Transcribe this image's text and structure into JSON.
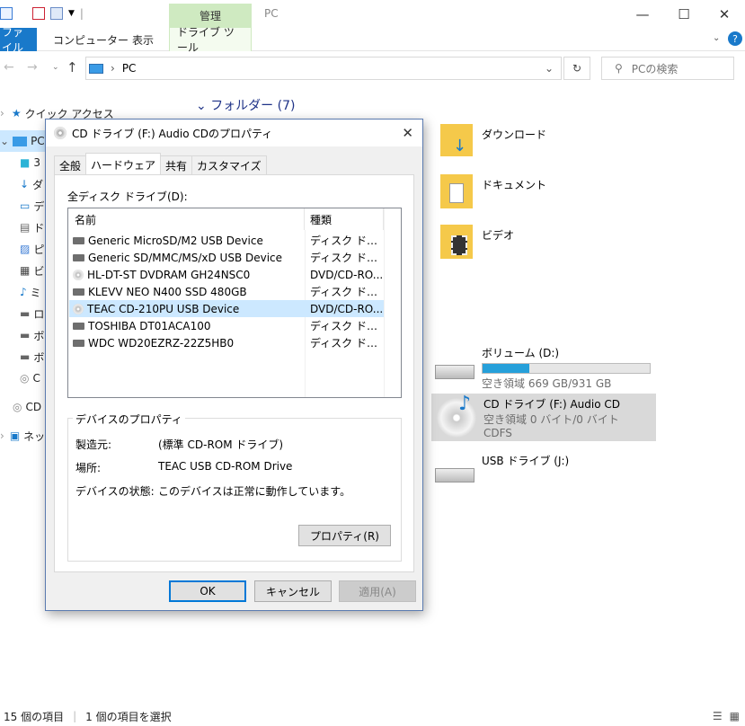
{
  "window": {
    "title": "PC",
    "context_group": "管理"
  },
  "ribbon": {
    "tabs": [
      "ファイル",
      "コンピューター",
      "表示"
    ],
    "context_tab": "ドライブ ツール"
  },
  "address": {
    "path": "PC",
    "search_placeholder": "PCの検索"
  },
  "nav": {
    "quick_access": "クイック アクセス",
    "pc": "PC",
    "items": [
      "3",
      "ダ",
      "デ",
      "ド",
      "ピ",
      "ビ",
      "ミ",
      "ロ",
      "ボ",
      "ボ",
      "C"
    ],
    "cd": "CD",
    "network": "ネッ"
  },
  "folders": {
    "header": "フォルダー (7)",
    "items": [
      "ダウンロード",
      "ドキュメント",
      "ビデオ"
    ]
  },
  "drives": [
    {
      "name": "ボリューム (D:)",
      "free": "空き領域 669 GB/931 GB",
      "used_fraction": 0.28
    },
    {
      "name": "CD ドライブ (F:) Audio CD",
      "free": "空き領域 0 バイト/0 バイト",
      "fs": "CDFS"
    },
    {
      "name": "USB ドライブ (J:)"
    }
  ],
  "status": {
    "count": "15 個の項目",
    "selected": "1 個の項目を選択"
  },
  "dialog": {
    "title": "CD ドライブ (F:) Audio CDのプロパティ",
    "tabs": [
      "全般",
      "ハードウェア",
      "共有",
      "カスタマイズ"
    ],
    "list_label": "全ディスク ドライブ(D):",
    "columns": [
      "名前",
      "種類"
    ],
    "rows": [
      {
        "name": "Generic MicroSD/M2 USB Device",
        "type": "ディスク ドライブ",
        "icon": "disk"
      },
      {
        "name": "Generic SD/MMC/MS/xD USB Device",
        "type": "ディスク ドライブ",
        "icon": "disk"
      },
      {
        "name": "HL-DT-ST DVDRAM GH24NSC0",
        "type": "DVD/CD-RO...",
        "icon": "cd"
      },
      {
        "name": "KLEVV NEO N400 SSD 480GB",
        "type": "ディスク ドライブ",
        "icon": "disk"
      },
      {
        "name": "TEAC CD-210PU USB Device",
        "type": "DVD/CD-RO...",
        "icon": "cd",
        "selected": true
      },
      {
        "name": "TOSHIBA DT01ACA100",
        "type": "ディスク ドライブ",
        "icon": "disk"
      },
      {
        "name": "WDC WD20EZRZ-22Z5HB0",
        "type": "ディスク ドライブ",
        "icon": "disk"
      }
    ],
    "props_group": "デバイスのプロパティ",
    "props": [
      {
        "label": "製造元:",
        "value": "(標準 CD-ROM ドライブ)"
      },
      {
        "label": "場所:",
        "value": "TEAC USB CD-ROM Drive"
      },
      {
        "label": "デバイスの状態:",
        "value": "このデバイスは正常に動作しています。"
      }
    ],
    "properties_button": "プロパティ(R)",
    "ok": "OK",
    "cancel": "キャンセル",
    "apply": "適用(A)"
  }
}
